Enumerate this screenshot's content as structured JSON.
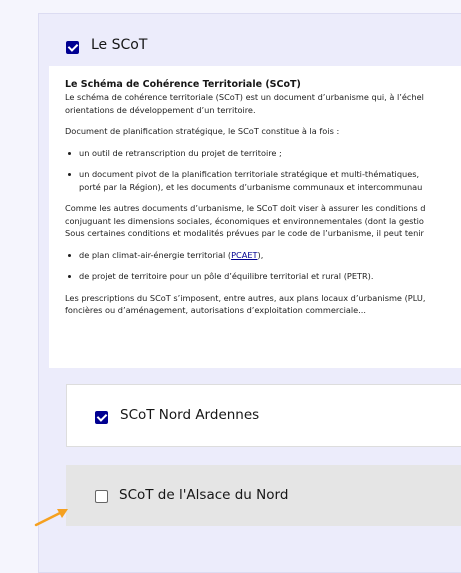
{
  "section": {
    "title": "Le SCoT",
    "checked": true
  },
  "description": {
    "heading": "Le Schéma de Cohérence Territoriale (SCoT)",
    "intro_line1": "Le schéma de cohérence territoriale (SCoT) est un document d’urbanisme qui, à l’échel",
    "intro_line2": "orientations de développement d’un territoire.",
    "para2": "Document de planification stratégique, le SCoT constitue à la fois :",
    "bullets": [
      "un outil de retranscription du projet de territoire ;",
      "un document pivot de la planification territoriale stratégique et multi-thématiques,"
    ],
    "bullet2_cont": "porté par la Région), et les documents d’urbanisme communaux et intercommunau",
    "para3_line1": "Comme les autres documents d’urbanisme, le SCoT doit viser à assurer les conditions d",
    "para3_line2": "conjuguant les dimensions sociales, économiques et environnementales (dont la gestio",
    "para3_line3": "Sous certaines conditions et modalités prévues par le code de l’urbanisme, il peut tenir",
    "bullet3_before": "de plan climat-air-énergie territorial (",
    "bullet3_link": "PCAET",
    "bullet3_after": "),",
    "bullet4": "de projet de territoire pour un pôle d’équilibre territorial et rural (PETR).",
    "para4_line1": "Les prescriptions du SCoT s’imposent, entre autres, aux plans locaux d’urbanisme (PLU,",
    "para4_line2": "foncières ou d’aménagement, autorisations d’exploitation commerciale..."
  },
  "items": [
    {
      "label": "SCoT Nord Ardennes",
      "checked": true
    },
    {
      "label": "SCoT de l'Alsace du Nord",
      "checked": false
    }
  ],
  "colors": {
    "accent": "#000091",
    "arrow": "#f5a020",
    "hover_bg": "#e5e5e5",
    "panel_bg": "#ececfb"
  },
  "icons": [
    "checkbox-checked-icon",
    "checkbox-unchecked-icon",
    "pointer-arrow-icon"
  ]
}
